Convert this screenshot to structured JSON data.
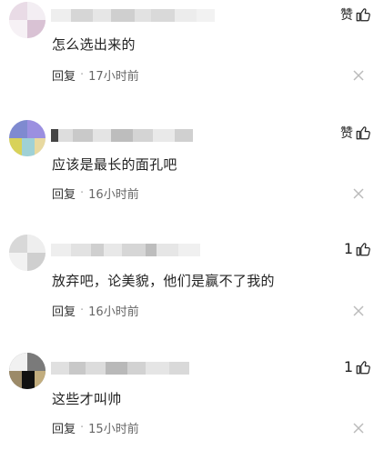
{
  "comments": [
    {
      "text": "怎么选出来的",
      "reply_label": "回复",
      "separator": "·",
      "time": "17小时前",
      "like_label": "赞",
      "like_count": ""
    },
    {
      "text": "应该是最长的面孔吧",
      "reply_label": "回复",
      "separator": "·",
      "time": "16小时前",
      "like_label": "赞",
      "like_count": ""
    },
    {
      "text": "放弃吧，论美貌，他们是赢不了我的",
      "reply_label": "回复",
      "separator": "·",
      "time": "16小时前",
      "like_label": "",
      "like_count": "1"
    },
    {
      "text": "这些才叫帅",
      "reply_label": "回复",
      "separator": "·",
      "time": "15小时前",
      "like_label": "",
      "like_count": "1"
    }
  ],
  "icons": {
    "thumb": "thumbs-up-icon",
    "close": "close-icon"
  },
  "colors": {
    "text": "#222222",
    "meta": "#666666",
    "close": "#bbbbbb"
  }
}
